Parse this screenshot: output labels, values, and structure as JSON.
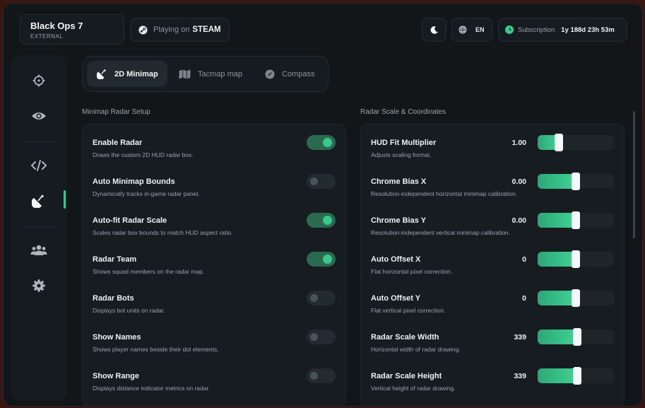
{
  "app": {
    "name": "Black Ops 7",
    "mode": "EXTERNAL"
  },
  "header": {
    "playing_on_label": "Playing on",
    "platform": "STEAM",
    "language": "EN",
    "subscription_label": "Subscription",
    "subscription_time": "1y 188d 23h 53m"
  },
  "tabs": [
    {
      "label": "2D Minimap",
      "icon": "radar-icon",
      "active": true
    },
    {
      "label": "Tacmap map",
      "icon": "map-icon",
      "active": false
    },
    {
      "label": "Compass",
      "icon": "compass-icon",
      "active": false
    }
  ],
  "sidebar": [
    {
      "icon": "crosshair-icon",
      "active": false
    },
    {
      "icon": "eye-icon",
      "active": false
    },
    {
      "icon": "code-icon",
      "active": false
    },
    {
      "icon": "radar-icon",
      "active": true
    },
    {
      "icon": "users-icon",
      "active": false
    },
    {
      "icon": "gear-icon",
      "active": false
    }
  ],
  "left": {
    "title": "Minimap Radar Setup",
    "rows": [
      {
        "title": "Enable Radar",
        "desc": "Draws the custom 2D HUD radar box.",
        "on": true
      },
      {
        "title": "Auto Minimap Bounds",
        "desc": "Dynamically tracks in-game radar panel.",
        "on": false
      },
      {
        "title": "Auto-fit Radar Scale",
        "desc": "Scales radar box bounds to match HUD aspect ratio.",
        "on": true
      },
      {
        "title": "Radar Team",
        "desc": "Shows squad members on the radar map.",
        "on": true
      },
      {
        "title": "Radar Bots",
        "desc": "Displays bot units on radar.",
        "on": false
      },
      {
        "title": "Show Names",
        "desc": "Shows player names beside their dot elements.",
        "on": false
      },
      {
        "title": "Show Range",
        "desc": "Displays distance indicator metrics on radar.",
        "on": false
      }
    ]
  },
  "right": {
    "title": "Radar Scale & Coordinates",
    "rows": [
      {
        "title": "HUD Fit Multiplier",
        "desc": "Adjusts scaling format.",
        "value": "1.00",
        "level": 0.28
      },
      {
        "title": "Chrome Bias X",
        "desc": "Resolution-independent horizontal minimap calibration.",
        "value": "0.00",
        "level": 0.5
      },
      {
        "title": "Chrome Bias Y",
        "desc": "Resolution-independent vertical minimap calibration.",
        "value": "0.00",
        "level": 0.5
      },
      {
        "title": "Auto Offset X",
        "desc": "Flat horizontal pixel correction.",
        "value": "0",
        "level": 0.5
      },
      {
        "title": "Auto Offset Y",
        "desc": "Flat vertical pixel correction.",
        "value": "0",
        "level": 0.5
      },
      {
        "title": "Radar Scale Width",
        "desc": "Horizontal width of radar drawing.",
        "value": "339",
        "level": 0.52
      },
      {
        "title": "Radar Scale Height",
        "desc": "Vertical height of radar drawing.",
        "value": "339",
        "level": 0.52
      }
    ]
  },
  "colors": {
    "accent": "#39c98c",
    "background": "#121619",
    "panel": "#171c20"
  }
}
